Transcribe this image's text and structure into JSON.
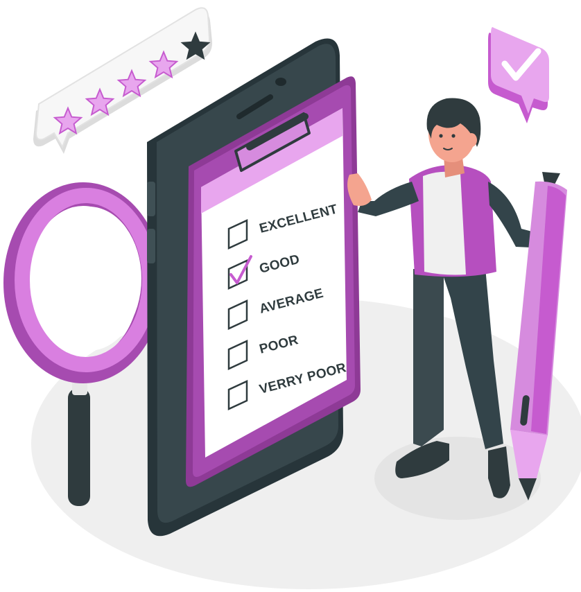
{
  "rating": {
    "stars_total": 5,
    "stars_filled": 4
  },
  "checklist": {
    "options": [
      {
        "label": "EXCELLENT",
        "checked": false
      },
      {
        "label": "GOOD",
        "checked": true
      },
      {
        "label": "AVERAGE",
        "checked": false
      },
      {
        "label": "POOR",
        "checked": false
      },
      {
        "label": "VERRY POOR",
        "checked": false
      }
    ]
  },
  "colors": {
    "accent": "#c65bcf",
    "accent_light": "#e8a6ee",
    "accent_dark": "#8e3a96",
    "dark": "#2f3b3e",
    "skin": "#f4a48f",
    "ground": "#ededed"
  }
}
